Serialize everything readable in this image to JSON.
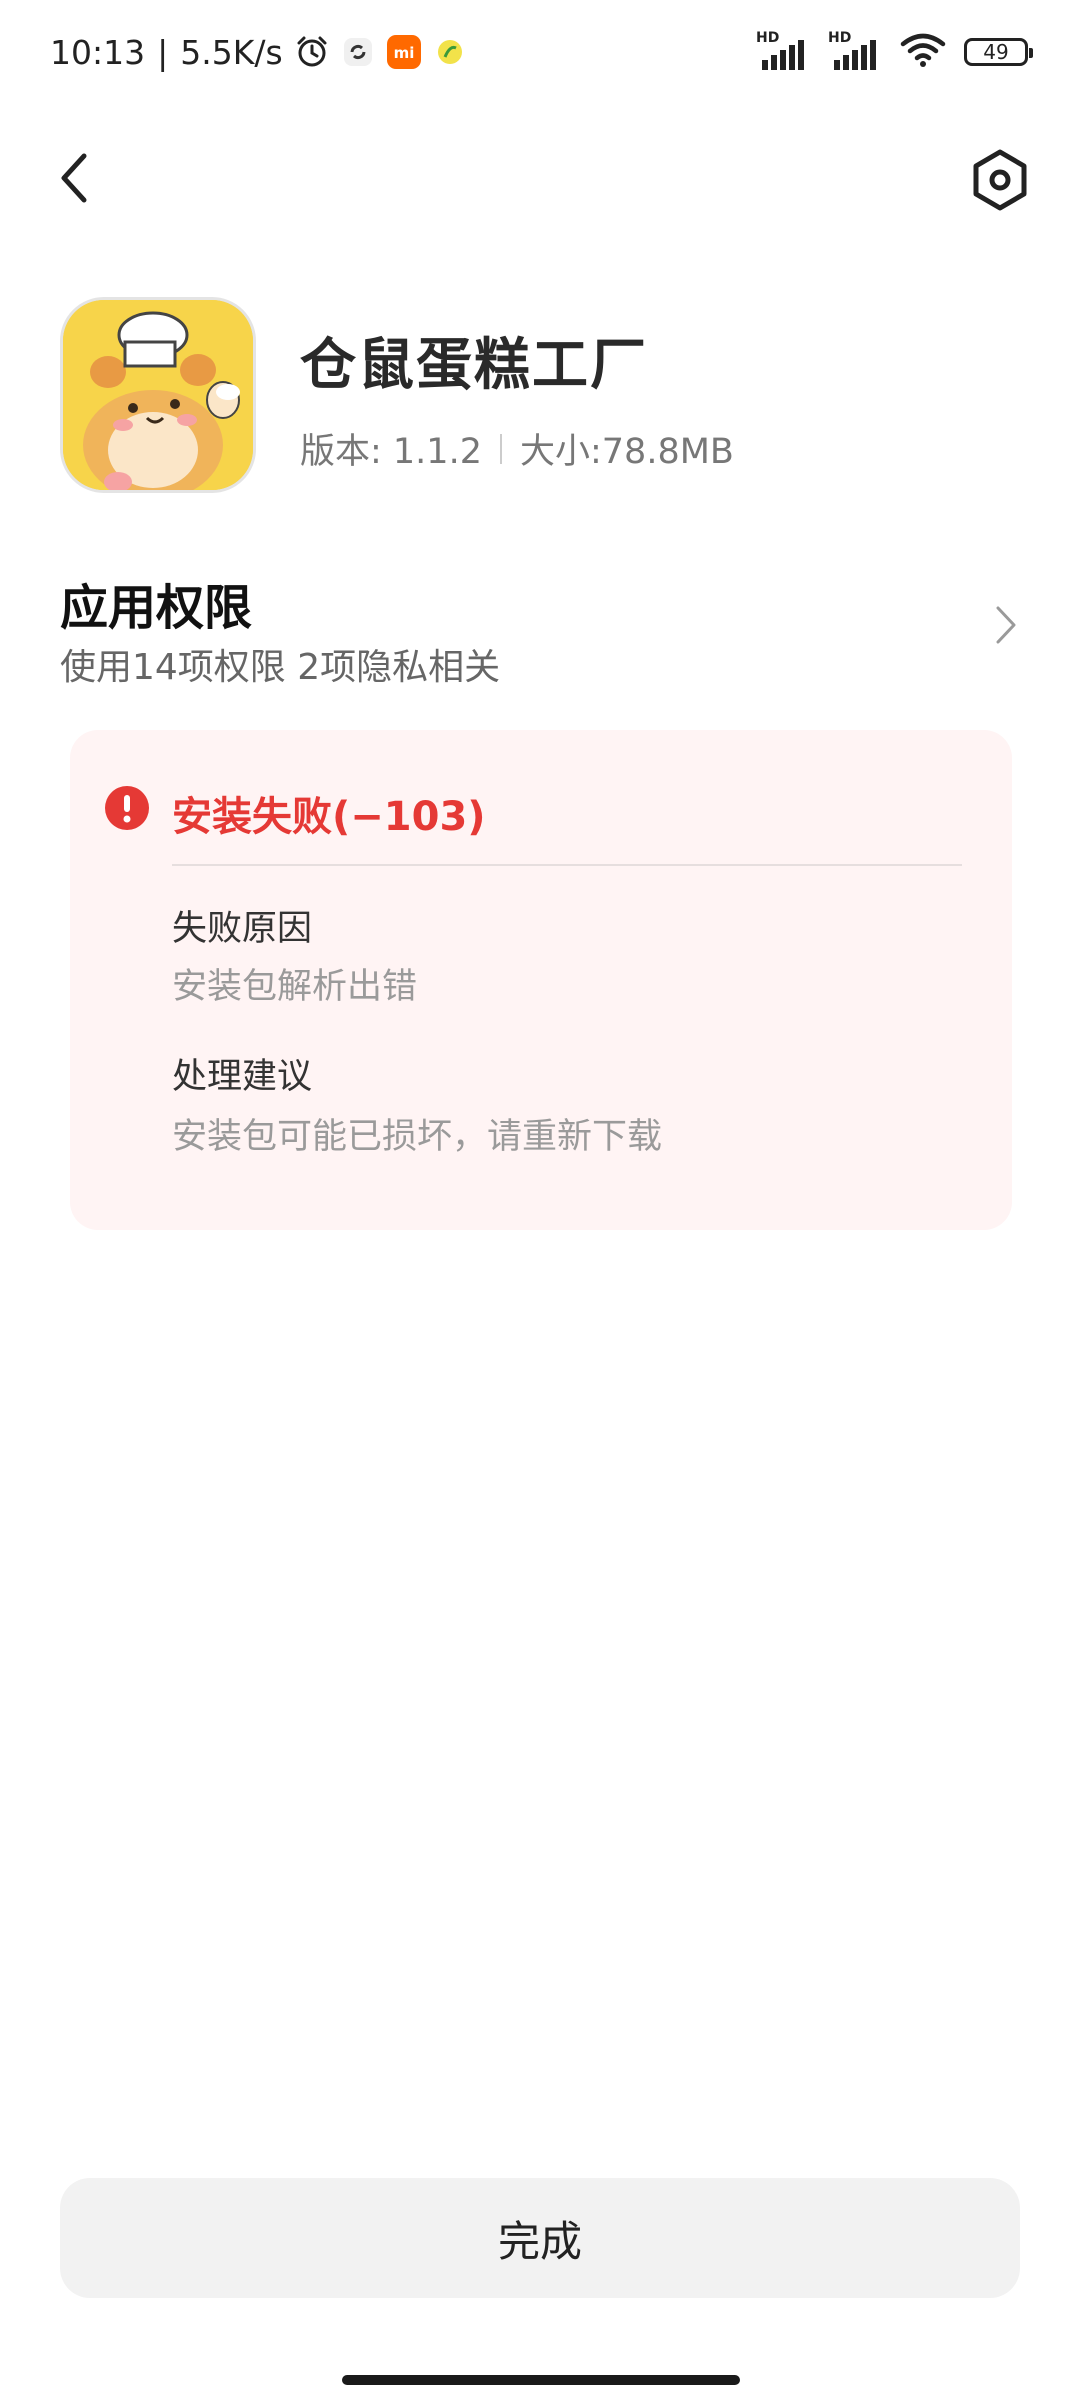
{
  "status_bar": {
    "time": "10:13",
    "separator": "|",
    "net_speed": "5.5K/s",
    "battery": "49",
    "signal_label_1": "HD",
    "signal_label_2": "HD",
    "mi_badge": "mi",
    "icons": [
      "alarm-icon",
      "sync-icon",
      "mi-app-icon",
      "lemon-app-icon",
      "signal-icon",
      "wifi-icon",
      "battery-icon"
    ]
  },
  "header": {
    "back_icon": "chevron-left-icon",
    "settings_icon": "hexagon-settings-icon"
  },
  "app": {
    "name": "仓鼠蛋糕工厂",
    "version": "版本: 1.1.2",
    "size": "大小:78.8MB",
    "icon": "hamster-chef-app-icon"
  },
  "permissions": {
    "title": "应用权限",
    "summary": "使用14项权限 2项隐私相关"
  },
  "error": {
    "title": "安装失败(−103)",
    "reason_label": "失败原因",
    "reason_value": "安装包解析出错",
    "suggestion_label": "处理建议",
    "suggestion_value": "安装包可能已损坏，请重新下载",
    "color": "#e53935"
  },
  "footer": {
    "done_label": "完成"
  },
  "colors": {
    "card_background": "#fff4f4",
    "button_background": "#f2f2f2",
    "error_red": "#e53935"
  }
}
